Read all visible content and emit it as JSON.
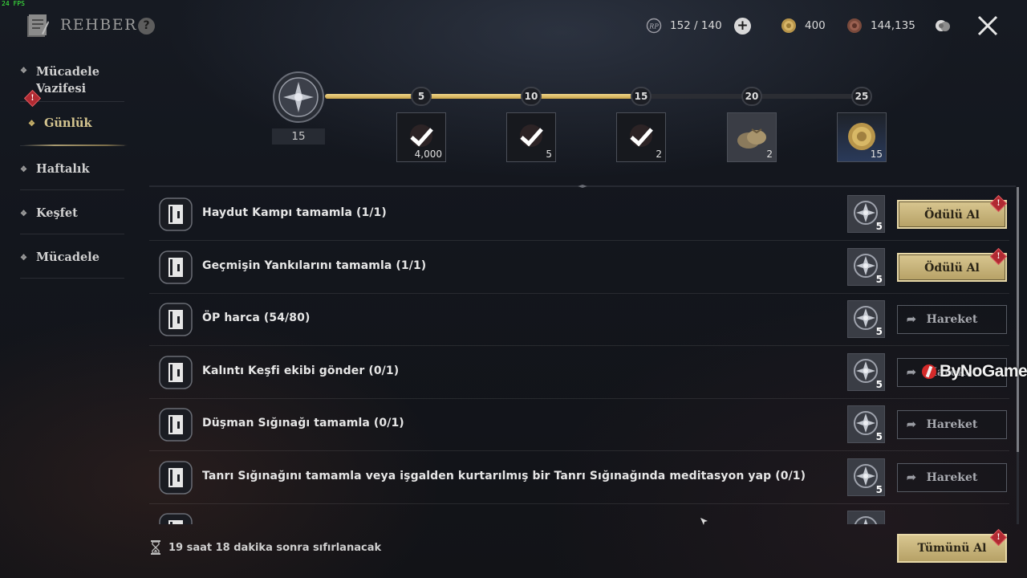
{
  "fps": "24 FPS",
  "header": {
    "title": "REHBER",
    "help": "?",
    "rp": "152 / 140",
    "gold": "400",
    "copper": "144,135",
    "plus": "+"
  },
  "sidebar": {
    "items": [
      {
        "label": "Mücadele Vazifesi",
        "line1": "Mücadele",
        "line2": "Vazifesi"
      },
      {
        "label": "Günlük",
        "alert": "!"
      },
      {
        "label": "Haftalık"
      },
      {
        "label": "Keşfet"
      },
      {
        "label": "Mücadele"
      }
    ]
  },
  "progress": {
    "current": "15",
    "current_value": 15,
    "max_value": 25,
    "milestones": [
      {
        "value": "5",
        "reward_count": "4,000",
        "claimed": true
      },
      {
        "value": "10",
        "reward_count": "5",
        "claimed": true
      },
      {
        "value": "15",
        "reward_count": "2",
        "claimed": true
      },
      {
        "value": "20",
        "reward_count": "2",
        "claimed": false,
        "icon": "pouch-icon"
      },
      {
        "value": "25",
        "reward_count": "15",
        "claimed": false,
        "icon": "gold-coin-icon"
      }
    ]
  },
  "tasks": [
    {
      "label": "Haydut Kampı tamamla (1/1)",
      "reward": "5",
      "button": "Ödülü Al",
      "type": "claim",
      "alert": "!"
    },
    {
      "label": "Geçmişin Yankılarını tamamla (1/1)",
      "reward": "5",
      "button": "Ödülü Al",
      "type": "claim",
      "alert": "!"
    },
    {
      "label": "ÖP harca (54/80)",
      "reward": "5",
      "button": "Hareket",
      "type": "go"
    },
    {
      "label": "Kalıntı Keşfi ekibi gönder (0/1)",
      "reward": "5",
      "button": "Hareket",
      "type": "go"
    },
    {
      "label": "Düşman Sığınağı tamamla (0/1)",
      "reward": "5",
      "button": "Hareket",
      "type": "go"
    },
    {
      "label": "Tanrı Sığınağını tamamla veya işgalden kurtarılmış bir Tanrı Sığınağında meditasyon yap (0/1)",
      "reward": "5",
      "button": "Hareket",
      "type": "go"
    }
  ],
  "footer": {
    "reset_text": "19 saat 18 dakika sonra sıfırlanacak",
    "claim_all": "Tümünü Al",
    "alert": "!"
  },
  "watermark": "ByNoGame",
  "colors": {
    "gold_accent": "#d8c690",
    "alert_red": "#b02a32",
    "track_fill": "#e0c070"
  }
}
